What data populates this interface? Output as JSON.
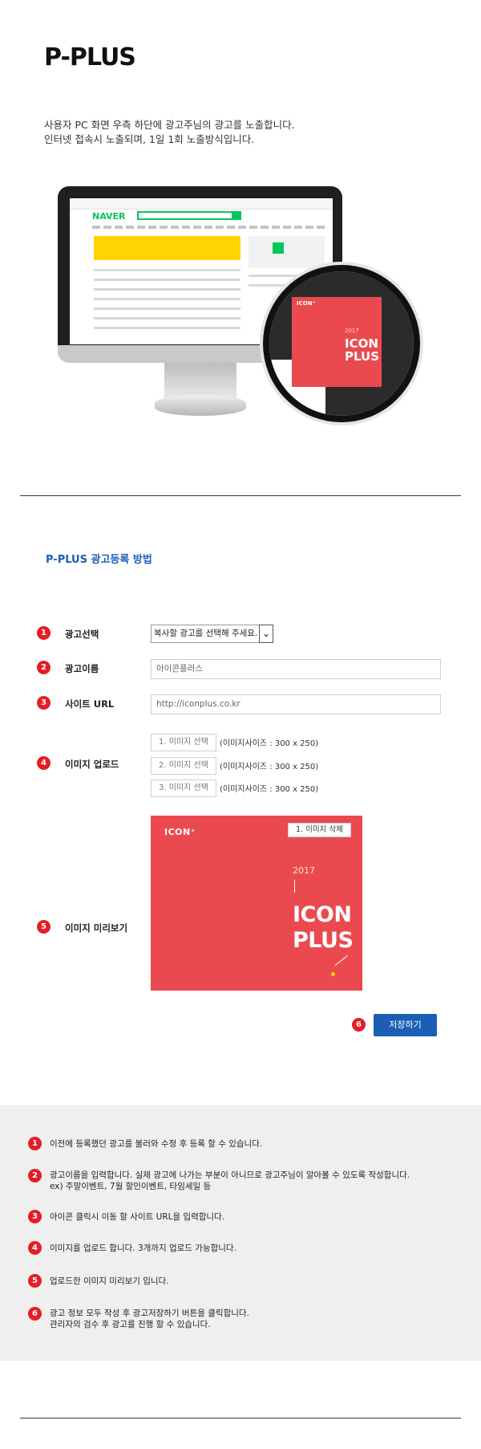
{
  "header": {
    "title": "P-PLUS",
    "intro_line1": "사용자 PC 화면 우측 하단에 광고주님의 광고를 노출합니다.",
    "intro_line2": "인터넷 접속시 노출되며, 1일 1회 노출방식입니다."
  },
  "illustration": {
    "naver_logo": "NAVER",
    "ad_logo": "ICON⁺",
    "ad_year": "2017",
    "ad_title_line1": "ICON",
    "ad_title_line2": "PLUS"
  },
  "section": {
    "title": "P-PLUS 광고등록 방법"
  },
  "form": {
    "rows": [
      {
        "num": "1",
        "label": "광고선택"
      },
      {
        "num": "2",
        "label": "광고이름"
      },
      {
        "num": "3",
        "label": "사이트 URL"
      },
      {
        "num": "4",
        "label": "이미지 업로드"
      },
      {
        "num": "5",
        "label": "이미지 미리보기"
      }
    ],
    "ad_select_value": "복사할 광고를 선택해 주세요.",
    "ad_name_value": "아이콘플러스",
    "site_url_value": "http://iconplus.co.kr",
    "uploads": [
      {
        "button": "1. 이미지 선택",
        "hint": "(이미지사이즈 : 300 x 250)"
      },
      {
        "button": "2. 이미지 선택",
        "hint": "(이미지사이즈 : 300 x 250)"
      },
      {
        "button": "3. 이미지 선택",
        "hint": "(이미지사이즈 : 300 x 250)"
      }
    ],
    "preview": {
      "logo": "ICON⁺",
      "delete_button": "1. 이미지 삭제",
      "year": "2017",
      "title_line1": "ICON",
      "title_line2": "PLUS"
    },
    "save": {
      "num": "6",
      "label": "저장하기"
    }
  },
  "notes": [
    {
      "num": "1",
      "lines": [
        "이전에 등록했던 광고를 불러와 수정 후 등록 할 수 있습니다."
      ]
    },
    {
      "num": "2",
      "lines": [
        "광고이름을 입력합니다. 실제 광고에 나가는 부분이 아니므로 광고주님이 알아볼 수 있도록 작성합니다.",
        "ex) 주말이벤트, 7월 할인이벤트, 타임세일 등"
      ]
    },
    {
      "num": "3",
      "lines": [
        "아이콘 클릭시 이동 할 사이트 URL을 입력합니다."
      ]
    },
    {
      "num": "4",
      "lines": [
        "이미지를 업로드 합니다. 3개까지 업로드 가능합니다."
      ]
    },
    {
      "num": "5",
      "lines": [
        "업로드한 이미지 미리보기 입니다."
      ]
    },
    {
      "num": "6",
      "lines": [
        "광고 정보 모두 작성 후 광고저장하기 버튼을 클릭합니다.",
        "관리자의 검수 후 광고를 진행 할 수 있습니다."
      ]
    }
  ]
}
